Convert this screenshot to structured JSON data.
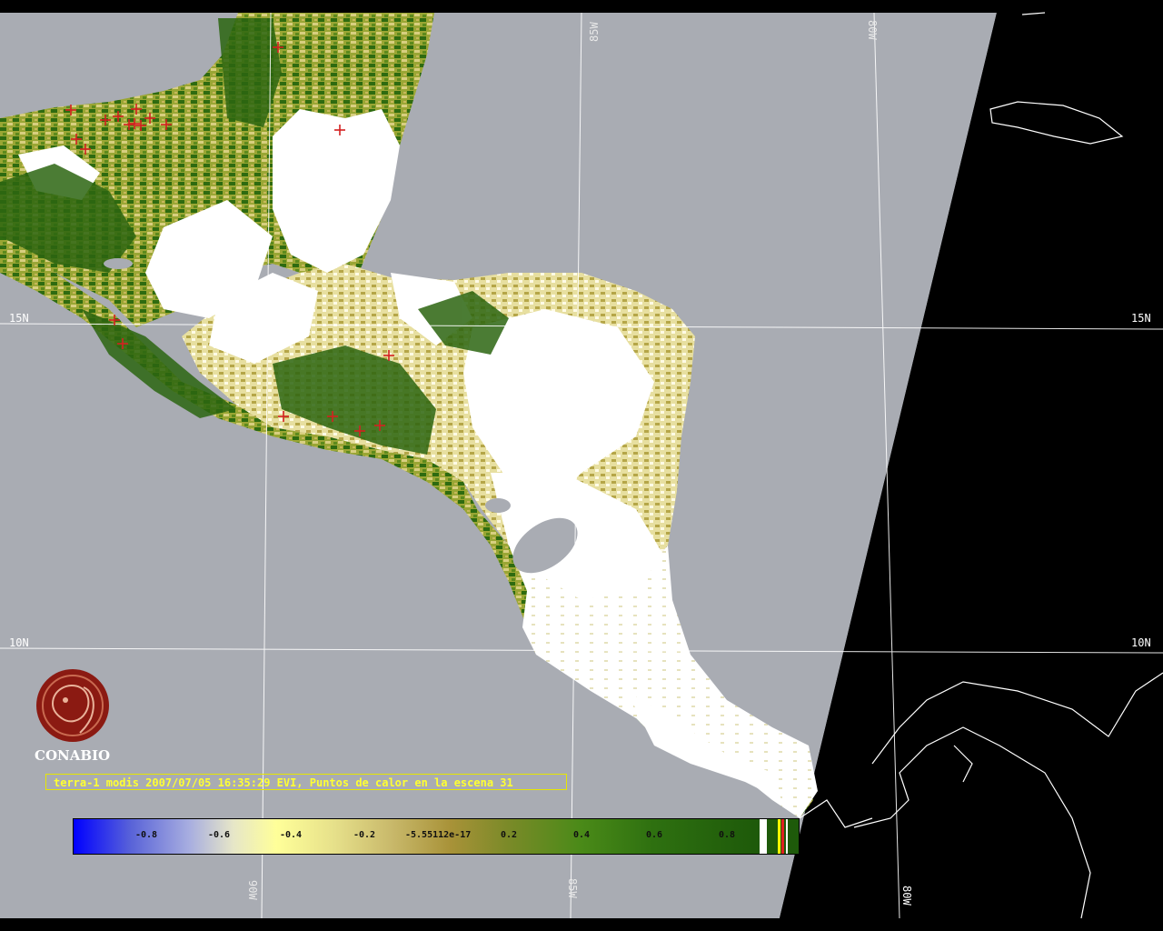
{
  "map": {
    "colors": {
      "ocean": "#a9acb3",
      "nodata": "#000000",
      "cloud": "#ffffff",
      "veg_dark": "#2e6b10",
      "veg_mid": "#8a9a2a",
      "veg_light": "#d8cf80",
      "coast_line": "#ffffff",
      "grid_line": "#ffffff",
      "hotspot": "#d42020"
    },
    "grid_labels": {
      "lon_85w_top": "85W",
      "lon_80w_top": "80W",
      "lon_90w_bottom": "90W",
      "lon_85w_bottom": "85W",
      "lon_80w_bottom": "80W",
      "lat_15n_left": "15N",
      "lat_15n_right": "15N",
      "lat_10n_left": "10N",
      "lat_10n_right": "10N"
    },
    "legend_icon": "plus-marker-icon"
  },
  "logo": {
    "text": "CONABIO",
    "icon": "conabio-seal-icon",
    "color": "#8b1a12"
  },
  "caption": {
    "text": "terra-1 modis 2007/07/05 16:35:29 EVI, Puntos de calor en la escena 31"
  },
  "colorbar": {
    "ticks": [
      "-0.8",
      "-0.6",
      "-0.4",
      "-0.2",
      "-5.55112e-17",
      "0.2",
      "0.4",
      "0.6",
      "0.8"
    ]
  }
}
